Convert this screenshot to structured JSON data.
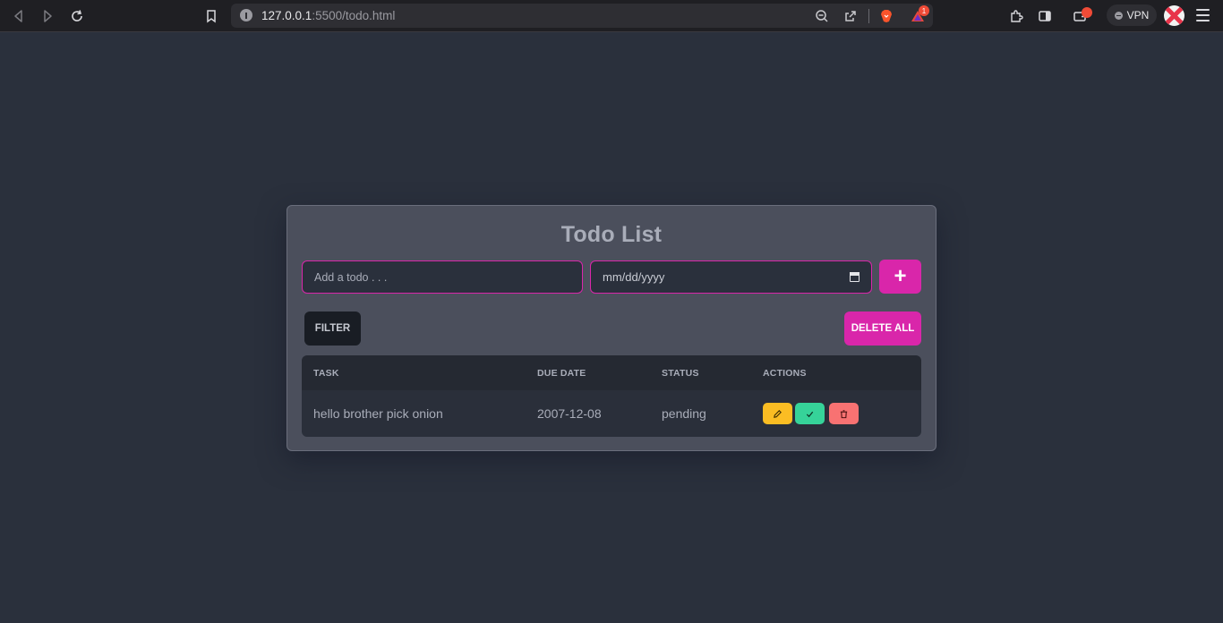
{
  "browser": {
    "url_host": "127.0.0.1",
    "url_path": ":5500/todo.html",
    "rewards_badge": "1",
    "vpn_label": "VPN"
  },
  "app": {
    "title": "Todo List",
    "todo_input": {
      "placeholder": "Add a todo . . .",
      "value": ""
    },
    "date_input": {
      "placeholder": "mm/dd/yyyy",
      "value": ""
    },
    "add_label": "+",
    "filter_label": "FILTER",
    "delete_all_label": "DELETE ALL",
    "table": {
      "headers": {
        "task": "TASK",
        "due_date": "DUE DATE",
        "status": "STATUS",
        "actions": "ACTIONS"
      },
      "rows": [
        {
          "task": "hello brother pick onion",
          "due_date": "2007-12-08",
          "status": "pending"
        }
      ]
    },
    "colors": {
      "accent": "#d926aa",
      "edit": "#fbbd23",
      "done": "#36d399",
      "delete": "#f87272",
      "background": "#2a303c",
      "card": "#4b4f5c"
    },
    "action_icons": [
      "pencil-icon",
      "check-icon",
      "trash-icon"
    ]
  }
}
